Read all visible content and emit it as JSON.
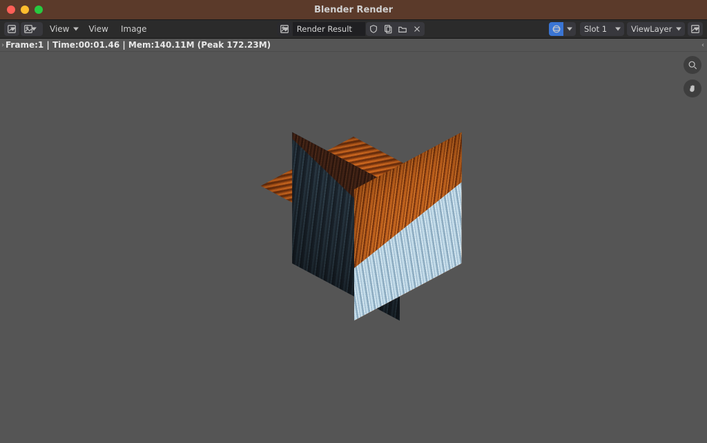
{
  "window": {
    "title": "Blender Render"
  },
  "toolbar": {
    "editor_type_icon": "image-editor-icon",
    "view_menu_a": "View",
    "view_menu_b": "View",
    "image_menu": "Image",
    "image_source_icon": "image-icon",
    "image_name": "Render Result",
    "fake_user_icon": "shield-icon",
    "new_icon": "new-image-icon",
    "open_icon": "folder-icon",
    "close_icon": "close-icon",
    "display_channels_icon": "sphere-icon",
    "slot_label": "Slot 1",
    "viewlayer_label": "ViewLayer",
    "pass_icon": "image-icon"
  },
  "status": {
    "text": "Frame:1 | Time:00:01.46 | Mem:140.11M (Peak 172.23M)"
  },
  "gizmos": {
    "zoom": "zoom-icon",
    "pan": "hand-icon"
  },
  "render": {
    "object": "Cube",
    "texture_desc": "fur texture, orange top / blue-grey lower"
  }
}
